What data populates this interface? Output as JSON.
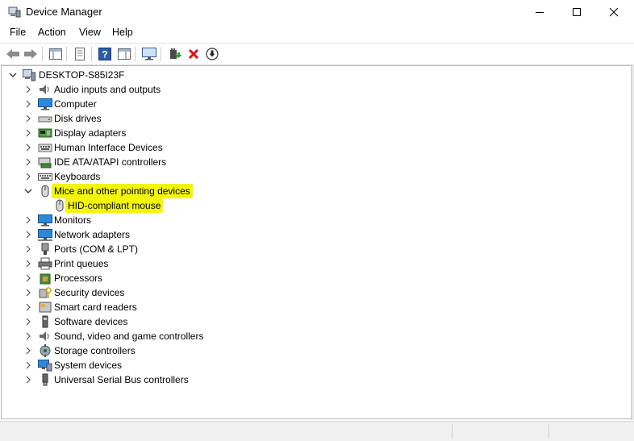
{
  "window": {
    "title": "Device Manager"
  },
  "menu": [
    "File",
    "Action",
    "View",
    "Help"
  ],
  "tree": {
    "root": "DESKTOP-S85I23F",
    "items": [
      {
        "label": "Audio inputs and outputs",
        "icon": "speaker-icon"
      },
      {
        "label": "Computer",
        "icon": "monitor-icon"
      },
      {
        "label": "Disk drives",
        "icon": "disk-drive-icon"
      },
      {
        "label": "Display adapters",
        "icon": "display-adapter-icon"
      },
      {
        "label": "Human Interface Devices",
        "icon": "hid-icon"
      },
      {
        "label": "IDE ATA/ATAPI controllers",
        "icon": "ide-controller-icon"
      },
      {
        "label": "Keyboards",
        "icon": "keyboard-icon"
      },
      {
        "label": "Mice and other pointing devices",
        "icon": "mouse-icon",
        "expanded": true,
        "highlighted": true
      },
      {
        "label": "HID-compliant mouse",
        "icon": "mouse-icon",
        "child": true,
        "highlighted": true
      },
      {
        "label": "Monitors",
        "icon": "monitor-icon"
      },
      {
        "label": "Network adapters",
        "icon": "network-icon"
      },
      {
        "label": "Ports (COM & LPT)",
        "icon": "port-icon"
      },
      {
        "label": "Print queues",
        "icon": "printer-icon"
      },
      {
        "label": "Processors",
        "icon": "processor-icon"
      },
      {
        "label": "Security devices",
        "icon": "security-key-icon"
      },
      {
        "label": "Smart card readers",
        "icon": "smart-card-icon"
      },
      {
        "label": "Software devices",
        "icon": "software-device-icon"
      },
      {
        "label": "Sound, video and game controllers",
        "icon": "speaker-icon"
      },
      {
        "label": "Storage controllers",
        "icon": "storage-controller-icon"
      },
      {
        "label": "System devices",
        "icon": "system-devices-icon"
      },
      {
        "label": "Universal Serial Bus controllers",
        "icon": "usb-icon"
      }
    ]
  },
  "colors": {
    "highlight": "#f4f60a",
    "accent": "#1e73c8",
    "remove": "#e01010"
  }
}
